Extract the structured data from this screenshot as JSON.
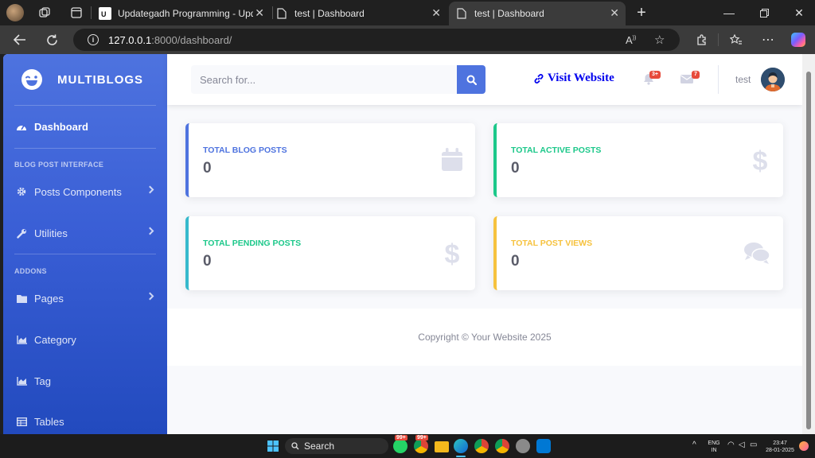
{
  "browser": {
    "tabs": [
      {
        "title": "Updategadh Programming - Upd",
        "favicon": "ug-logo-icon"
      },
      {
        "title": "test | Dashboard",
        "favicon": "page-icon"
      },
      {
        "title": "test | Dashboard",
        "favicon": "page-icon"
      }
    ],
    "url_host": "127.0.0.1",
    "url_path": ":8000/dashboard/"
  },
  "sidebar": {
    "brand": "MULTIBLOGS",
    "dashboard": "Dashboard",
    "heading_interface": "BLOG POST INTERFACE",
    "posts_components": "Posts Components",
    "utilities": "Utilities",
    "heading_addons": "ADDONS",
    "pages": "Pages",
    "category": "Category",
    "tag": "Tag",
    "tables": "Tables"
  },
  "topbar": {
    "search_placeholder": "Search for...",
    "visit_website": "Visit Website",
    "alerts_count": "3+",
    "messages_count": "7",
    "username": "test"
  },
  "cards": [
    {
      "label": "TOTAL BLOG POSTS",
      "value": "0",
      "color": "#4e73df",
      "icon": "calendar-icon"
    },
    {
      "label": "TOTAL ACTIVE POSTS",
      "value": "0",
      "color": "#1cc88a",
      "icon": "dollar-icon"
    },
    {
      "label": "TOTAL PENDING POSTS",
      "value": "0",
      "color": "#36b9cc",
      "icon": "dollar-icon"
    },
    {
      "label": "TOTAL POST VIEWS",
      "value": "0",
      "color": "#f6c23e",
      "icon": "comments-icon"
    }
  ],
  "footer": {
    "copyright": "Copyright © Your Website 2025"
  },
  "taskbar": {
    "search": "Search",
    "lang_top": "ENG",
    "lang_bottom": "IN",
    "time": "23:47",
    "date": "28-01-2025",
    "badge_a": "99+",
    "badge_b": "99+"
  }
}
